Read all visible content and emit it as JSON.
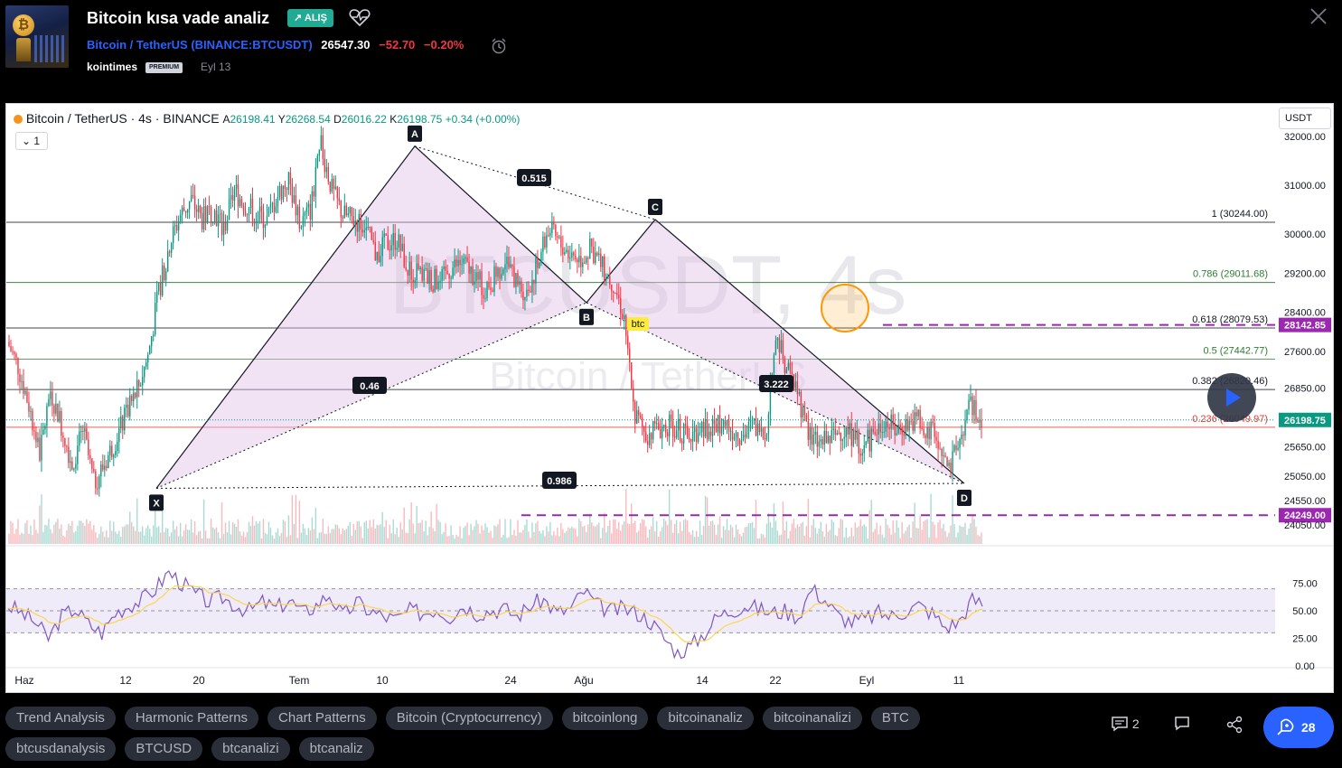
{
  "header": {
    "title": "Bitcoin kısa vade analiz",
    "badge": "ALIŞ",
    "badge_arrow": "↗",
    "symbol_name": "Bitcoin / TetherUS",
    "symbol_code": "(BINANCE:BTCUSDT)",
    "price": "26547.30",
    "change": "−52.70",
    "change_pct": "−0.20%",
    "author": "kointimes",
    "premium": "PREMIUM",
    "date": "Eyl 13",
    "thumb_letter": "₿"
  },
  "chart": {
    "legend_title": "Bitcoin / TetherUS · 4s · BINANCE",
    "o_label": "A",
    "o_value": "26198.41",
    "h_label": "Y",
    "h_value": "26268.54",
    "l_label": "D",
    "l_value": "26016.22",
    "c_label": "K",
    "c_value": "26198.75",
    "change": "+0.34 (+0.00%)",
    "indicator_count": "1",
    "currency": "USDT",
    "watermark_1": "BTCUSDT, 4s",
    "watermark_2": "Bitcoin / TetherUS"
  },
  "chart_data": {
    "type": "candlestick",
    "symbol": "BTCUSDT",
    "interval": "4s",
    "y_ticks": [
      32000,
      31000,
      30000,
      29200,
      28400,
      27600,
      26850,
      26198.75,
      25650,
      25050,
      24550,
      24050
    ],
    "y_tick_labels": [
      "32000.00",
      "31000.00",
      "30000.00",
      "29200.00",
      "28400.00",
      "27600.00",
      "26850.00",
      "26198.75",
      "25650.00",
      "25050.00",
      "24550.00",
      "24050.00"
    ],
    "x_ticks": [
      "Haz",
      "12",
      "20",
      "Tem",
      "10",
      "24",
      "Ağu",
      "14",
      "22",
      "Eyl",
      "11"
    ],
    "price_path": [
      27800,
      27300,
      26500,
      25500,
      26800,
      26100,
      25300,
      26000,
      24900,
      25300,
      25800,
      26300,
      26800,
      27500,
      28800,
      29800,
      30400,
      30700,
      30300,
      30500,
      30100,
      30900,
      30600,
      30400,
      30300,
      30800,
      31100,
      30200,
      30500,
      31800,
      30900,
      30400,
      30300,
      30200,
      29600,
      29800,
      29900,
      29300,
      29200,
      29100,
      29000,
      29300,
      29400,
      29200,
      28900,
      29100,
      29500,
      29000,
      28800,
      29400,
      30100,
      29800,
      29600,
      29500,
      29700,
      29300,
      29000,
      28300,
      26300,
      25900,
      26000,
      26100,
      26000,
      25800,
      26100,
      26000,
      26200,
      26000,
      25900,
      26100,
      25800,
      27900,
      27300,
      26800,
      25900,
      25700,
      25800,
      26000,
      25900,
      25600,
      25900,
      26200,
      26000,
      26100,
      26200,
      26000,
      25800,
      25100,
      25800,
      26500,
      26200
    ],
    "last_price": "26198.75",
    "alert_levels": [
      "28142.85",
      "24249.00"
    ],
    "fib_levels": [
      {
        "ratio": "1",
        "value": "30244.00"
      },
      {
        "ratio": "0.786",
        "value": "29011.68"
      },
      {
        "ratio": "0.618",
        "value": "28079.53"
      },
      {
        "ratio": "0.5",
        "value": "27442.77"
      },
      {
        "ratio": "0.382",
        "value": "26820.46"
      },
      {
        "ratio": "0.236",
        "value": "26049.97"
      }
    ],
    "harmonic_points": [
      {
        "label": "X",
        "price": 24800
      },
      {
        "label": "A",
        "price": 31800
      },
      {
        "label": "B",
        "price": 28600
      },
      {
        "label": "C",
        "price": 30300
      },
      {
        "label": "D",
        "price": 24900
      }
    ],
    "harmonic_ratios": [
      "0.515",
      "0.46",
      "3.222",
      "0.986"
    ],
    "annotation": "btc",
    "rsi": {
      "y_tick_labels": [
        "75.00",
        "50.00",
        "25.00",
        "0.00"
      ],
      "upper": 70,
      "lower": 30,
      "values": [
        55,
        48,
        40,
        25,
        45,
        52,
        38,
        30,
        48,
        55,
        60,
        70,
        85,
        75,
        65,
        58,
        62,
        55,
        50,
        58,
        52,
        60,
        48,
        55,
        65,
        45,
        58,
        50,
        45,
        42,
        50,
        48,
        52,
        45,
        55,
        48,
        50,
        52,
        45,
        55,
        60,
        48,
        52,
        68,
        55,
        50,
        52,
        48,
        40,
        25,
        12,
        18,
        30,
        45,
        50,
        55,
        52,
        48,
        50,
        45,
        70,
        60,
        45,
        40,
        42,
        48,
        45,
        50,
        55,
        48,
        35,
        40,
        60,
        55
      ]
    }
  },
  "tags": [
    "Trend Analysis",
    "Harmonic Patterns",
    "Chart Patterns",
    "Bitcoin (Cryptocurrency)",
    "bitcoinlong",
    "bitcoinanaliz",
    "bitcoinanalizi",
    "BTC",
    "btcusdanalysis",
    "BTCUSD",
    "btcanalizi",
    "btcanaliz"
  ],
  "footer": {
    "comments": "2",
    "boosts": "28"
  },
  "colors": {
    "buy_badge": "#22ab94",
    "up": "#089981",
    "down": "#f23645",
    "harmonic_fill": "#e1bee7",
    "alert_line": "#9c27b0",
    "rsi_line": "#7e57c2",
    "rsi_ma": "#ffd54f",
    "boost": "#2962ff"
  }
}
